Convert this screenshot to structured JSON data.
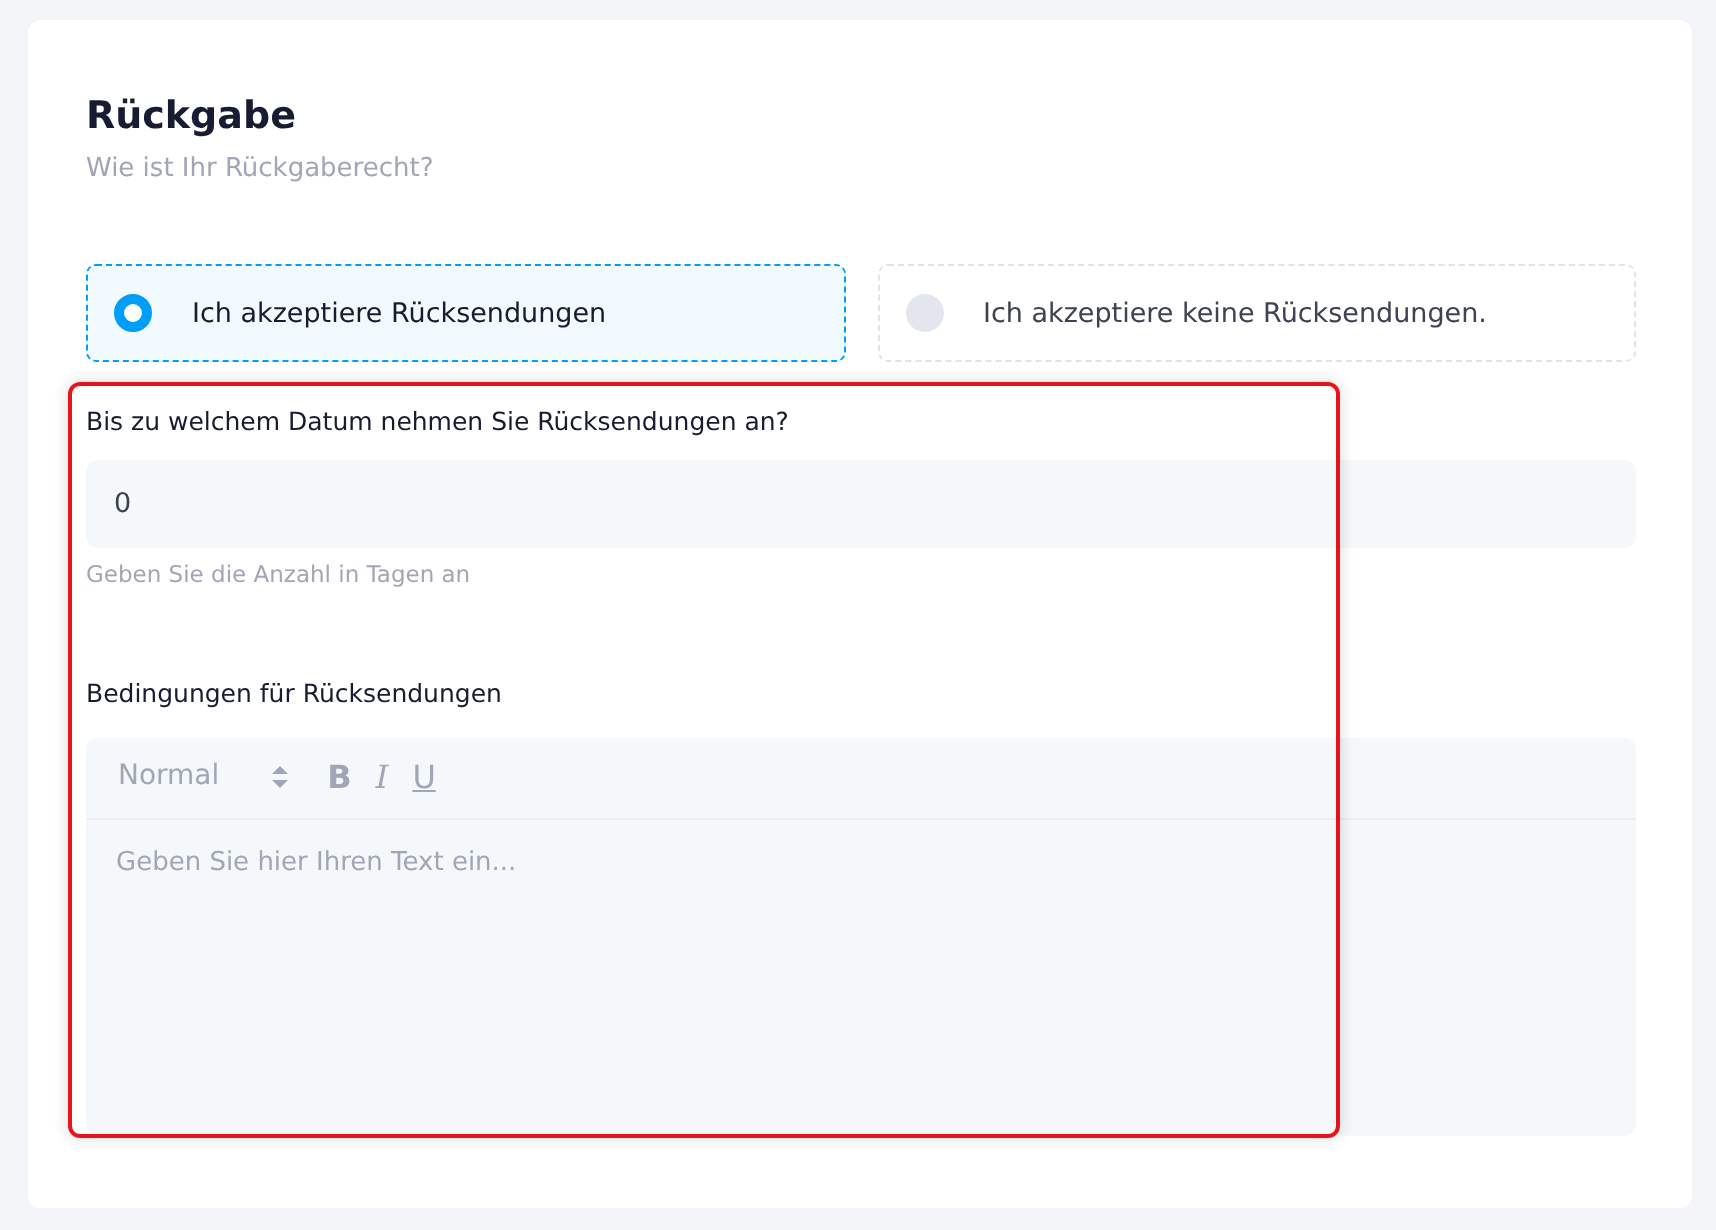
{
  "title": "Rückgabe",
  "subtitle": "Wie ist Ihr Rückgaberecht?",
  "options": [
    {
      "label": "Ich akzeptiere Rücksendungen",
      "selected": true
    },
    {
      "label": "Ich akzeptiere keine Rücksendungen.",
      "selected": false
    }
  ],
  "days_field": {
    "label": "Bis zu welchem Datum nehmen Sie Rücksendungen an?",
    "value": "0",
    "hint": "Geben Sie die Anzahl in Tagen an"
  },
  "conditions_editor": {
    "label": "Bedingungen für Rücksendungen",
    "format_select": "Normal",
    "toolbar": [
      {
        "kind": "bold",
        "label": "B"
      },
      {
        "kind": "italic",
        "label": "I"
      },
      {
        "kind": "underline",
        "label": "U"
      }
    ],
    "placeholder": "Geben Sie hier Ihren Text ein..."
  }
}
